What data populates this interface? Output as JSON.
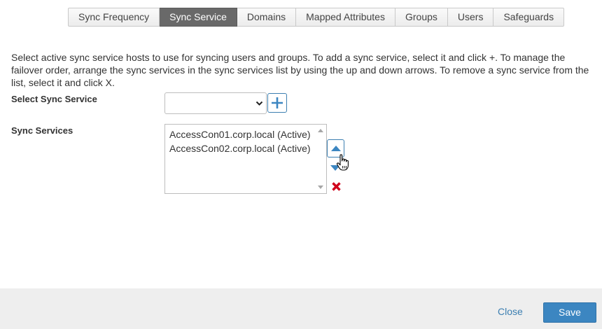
{
  "tabs": [
    {
      "label": "Sync Frequency"
    },
    {
      "label": "Sync Service"
    },
    {
      "label": "Domains"
    },
    {
      "label": "Mapped Attributes"
    },
    {
      "label": "Groups"
    },
    {
      "label": "Users"
    },
    {
      "label": "Safeguards"
    }
  ],
  "active_tab": "Sync Service",
  "description": "Select active sync service hosts to use for syncing users and groups. To add a sync service, select it and click +. To manage the failover order, arrange the sync services in the sync services list by using the up and down arrows. To remove a sync service from the list, select it and click X.",
  "select_sync_service": {
    "label": "Select Sync Service",
    "value": ""
  },
  "sync_services": {
    "label": "Sync Services",
    "items": [
      "AccessCon01.corp.local (Active)",
      "AccessCon02.corp.local (Active)"
    ]
  },
  "footer": {
    "close_label": "Close",
    "save_label": "Save"
  },
  "colors": {
    "accent": "#3c86c1",
    "active_tab_bg": "#696969",
    "remove_red": "#d0021b",
    "footer_bg": "#eeeeee"
  },
  "icons": [
    "plus-icon",
    "chevron-down-icon",
    "arrow-up-icon",
    "arrow-down-icon",
    "remove-x-icon",
    "hand-cursor-icon"
  ]
}
